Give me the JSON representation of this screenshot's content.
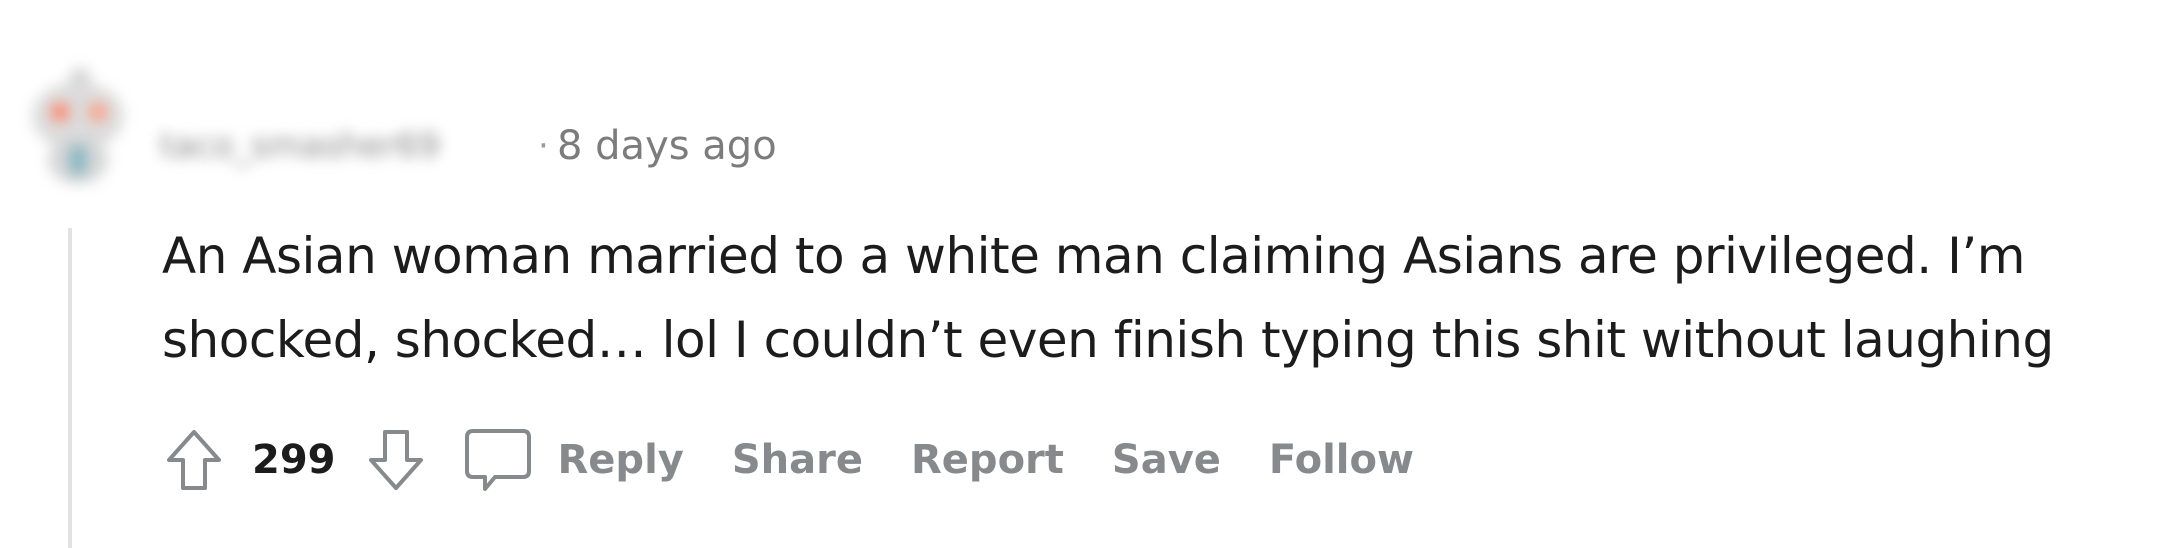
{
  "comment": {
    "author": "taco_smasher69",
    "separator": "·",
    "timestamp": "8 days ago",
    "body_lines": [
      "An Asian woman married to a white man claiming Asians are privileged. I’m",
      "shocked, shocked… lol I couldn’t even finish typing this shit without laughing"
    ],
    "vote_count": "299"
  },
  "actions": {
    "upvote_icon": "arrow-up-outline-icon",
    "downvote_icon": "arrow-down-outline-icon",
    "comment_icon": "speech-bubble-icon",
    "reply_label": "Reply",
    "share_label": "Share",
    "report_label": "Report",
    "save_label": "Save",
    "follow_label": "Follow"
  },
  "colors": {
    "text_primary": "#1c1c1c",
    "text_meta": "#7c7c7c",
    "action_gray": "#878a8c",
    "icon_gray": "#878a8c",
    "thread_line": "#e2e2e2"
  }
}
